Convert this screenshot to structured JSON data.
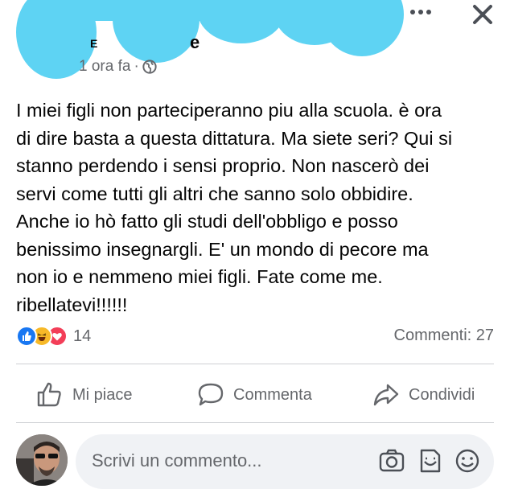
{
  "post_header": {
    "author_name_visible": "e",
    "timestamp": "1 ora fa",
    "separator": "·",
    "audience_icon": "globe-icon",
    "more_icon": "more-options-icon",
    "close_icon": "close-icon"
  },
  "post": {
    "lines": [
      "I miei figli non parteciperanno piu alla scuola. è ora",
      "di dire basta a questa dittatura. Ma siete seri? Qui si",
      "stanno perdendo i sensi proprio. Non nascerò dei",
      "servi come tutti gli altri che sanno solo obbidire.",
      "Anche io hò fatto gli studi dell'obbligo e posso",
      "benissimo insegnargli. E' un mondo di pecore ma",
      "non io e nemmeno miei figli. Fate come me.",
      "ribellatevi!!!!!!"
    ]
  },
  "reactions": {
    "icons": [
      "like-reaction-icon",
      "haha-reaction-icon",
      "love-reaction-icon"
    ],
    "count": "14"
  },
  "comments_count": "Commenti: 27",
  "actions": {
    "like": "Mi piace",
    "comment": "Commenta",
    "share": "Condividi"
  },
  "comment_box": {
    "placeholder": "Scrivi un commento...",
    "icons": [
      "camera-icon",
      "gif-icon",
      "emoji-icon"
    ]
  },
  "colors": {
    "redaction_blue": "#5ed3f3",
    "like_blue": "#1877f2",
    "haha_yellow": "#f7b928",
    "love_red": "#f33e58",
    "secondary_text": "#65676b"
  }
}
